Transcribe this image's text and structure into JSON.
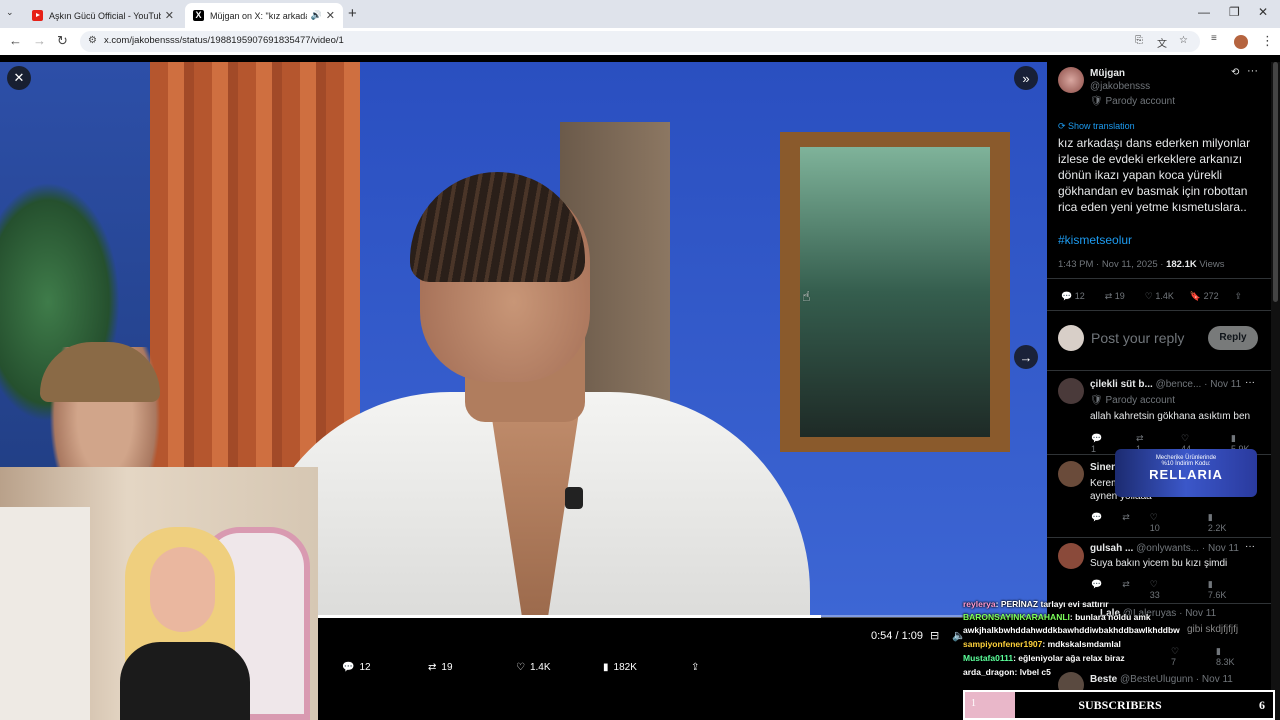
{
  "browser": {
    "tabs": [
      {
        "title": "Aşkın Gücü Official - YouTube",
        "active": false,
        "icon": "youtube-icon"
      },
      {
        "title": "Müjgan on X: \"kız arkadaşı",
        "active": true,
        "icon": "x-icon"
      }
    ],
    "url": "x.com/jakobensss/status/1988195907691835477/video/1"
  },
  "video": {
    "time": "0:54 / 1:09",
    "progress": 0.69,
    "actions": {
      "replies": "12",
      "reposts": "19",
      "likes": "1.4K",
      "views": "182K"
    }
  },
  "post": {
    "author_name": "Müjgan",
    "author_handle": "@jakobensss",
    "parody_label": "Parody account",
    "translate_label": "Show translation",
    "text": "kız arkadaşı dans ederken milyonlar izlese de evdeki erkeklere arkanızı dönün ikazı yapan koca yürekli gökhandan ev basmak için robottan rica eden yeni yetme kısmetuslara..",
    "hashtag": "#kismetseolur",
    "timestamp": "1:43 PM · Nov 11, 2025 · ",
    "views_count": "182.1K",
    "views_label": " Views",
    "stats": {
      "replies": "12",
      "reposts": "19",
      "likes": "1.4K",
      "bookmarks": "272"
    }
  },
  "reply_box": {
    "placeholder": "Post your reply",
    "button": "Reply"
  },
  "replies": [
    {
      "name": "çilekli süt b...",
      "handle": "@bence...",
      "date": "· Nov 11",
      "parody": "Parody account",
      "text": "allah kahretsin gökhana asıktım ben",
      "stats": [
        "1",
        "1",
        "44",
        "5.9K"
      ]
    },
    {
      "name": "Sinen",
      "handle": "",
      "date": "",
      "text": "Kerem sensin kardeşim aynen yollaaa",
      "stats": [
        "",
        "",
        "10",
        "2.2K"
      ]
    },
    {
      "name": "gulsah ...",
      "handle": "@onlywants...",
      "date": "· Nov 11",
      "text": "Suya bakın yicem bu kızı şimdi",
      "stats": [
        "",
        "",
        "33",
        "7.6K"
      ]
    },
    {
      "name": "Lale",
      "handle": "@Laleruyas",
      "date": "· Nov 11",
      "text": "gibi skdjfjfjfj",
      "stats": [
        "",
        "",
        "7",
        "8.3K"
      ]
    },
    {
      "name": "Beste",
      "handle": "@BesteUlugunn",
      "date": "· Nov 11",
      "text": "",
      "stats": []
    }
  ],
  "ad": {
    "line1": "Mecherike Ürünlerinde",
    "line2": "%10 İndirim Kodu:",
    "brand": "RELLARIA"
  },
  "chat": [
    {
      "user": "reylerya",
      "msg": ": PERİNAZ tarlayı evi sattırır",
      "color": "#ff9ad2"
    },
    {
      "user": "BARONSAYINKARAHANLI",
      "msg": ": bunlara noldu amk awkjhalkbwhddahwddkbawhddiwbakhddbawlkhddbw",
      "color": "#7cff5a"
    },
    {
      "user": "sampiyonfener1907",
      "msg": ": mdkskalsmdamlal",
      "color": "#ffd23b"
    },
    {
      "user": "Mustafa0111",
      "msg": ": eğleniyolar ağa relax biraz",
      "color": "#5bff9a"
    },
    {
      "user": "arda_dragon",
      "msg": ": lvbel c5",
      "color": "#ffffff"
    }
  ],
  "subscribers": {
    "left": "1",
    "label": "SUBSCRIBERS",
    "count": "6"
  }
}
